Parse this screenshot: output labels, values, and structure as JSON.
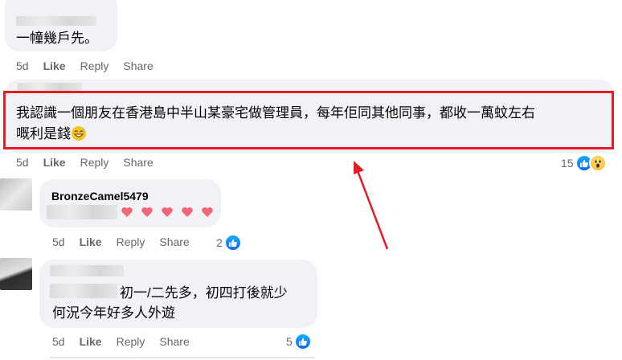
{
  "colors": {
    "bubble": "#f0f2f5",
    "action_text": "#65676b",
    "highlight": "#e51c23",
    "like_blue": "#0866ff"
  },
  "comments": [
    {
      "text": "一幢幾戶先。",
      "time": "5d",
      "like": "Like",
      "reply": "Reply",
      "share": "Share"
    },
    {
      "text_line1": "我認識一個朋友在香港島中半山某豪宅做管理員，每年佢同其他同事，都收一萬蚊左右",
      "text_line2": "嘅利是錢",
      "emoji": "grinning-sweat-icon",
      "time": "5d",
      "like": "Like",
      "reply": "Reply",
      "share": "Share",
      "reaction_count": "15",
      "reactions": [
        "like-icon",
        "wow-icon"
      ]
    },
    {
      "name": "BronzeCamel5479",
      "emoji": "heart-icon",
      "time": "5d",
      "like": "Like",
      "reply": "Reply",
      "share": "Share",
      "reaction_count": "2",
      "reactions": [
        "like-icon"
      ]
    },
    {
      "text_line1": "初一/二先多，初四打後就少",
      "text_line2": "何況今年好多人外遊",
      "time": "5d",
      "like": "Like",
      "reply": "Reply",
      "share": "Share",
      "reaction_count": "5",
      "reactions": [
        "like-icon"
      ]
    }
  ]
}
